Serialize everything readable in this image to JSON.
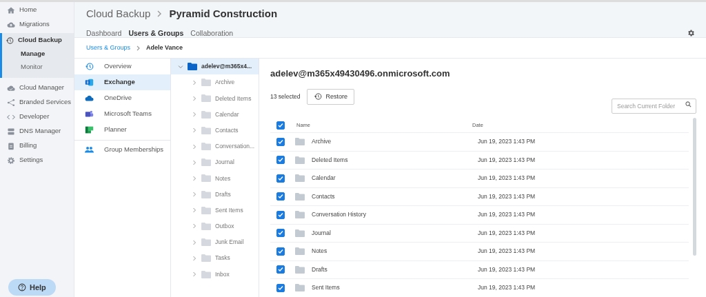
{
  "sidebar": {
    "items": [
      {
        "label": "Home",
        "selected": false
      },
      {
        "label": "Migrations",
        "selected": false
      },
      {
        "label": "Cloud Backup",
        "selected": true,
        "expanded": true,
        "children": [
          {
            "label": "Manage",
            "selected": true
          },
          {
            "label": "Monitor",
            "selected": false
          }
        ]
      },
      {
        "label": "Cloud Manager",
        "selected": false
      },
      {
        "label": "Branded Services",
        "selected": false
      },
      {
        "label": "Developer",
        "selected": false
      },
      {
        "label": "DNS Manager",
        "selected": false
      },
      {
        "label": "Billing",
        "selected": false
      },
      {
        "label": "Settings",
        "selected": false
      }
    ],
    "help": "Help"
  },
  "header": {
    "title": "Cloud Backup",
    "subtitle": "Pyramid Construction",
    "tabs": [
      {
        "label": "Dashboard",
        "selected": false
      },
      {
        "label": "Users & Groups",
        "selected": true
      },
      {
        "label": "Collaboration",
        "selected": false
      }
    ]
  },
  "breadcrumb": {
    "link": "Users & Groups",
    "current": "Adele Vance"
  },
  "services": [
    {
      "label": "Overview",
      "selected": false
    },
    {
      "label": "Exchange",
      "selected": true
    },
    {
      "label": "OneDrive",
      "selected": false
    },
    {
      "label": "Microsoft Teams",
      "selected": false
    },
    {
      "label": "Planner",
      "selected": false
    },
    {
      "label": "Group Memberships",
      "selected": false
    }
  ],
  "tree": [
    {
      "label": "adelev@m365x4...",
      "selected": true,
      "expanded": true,
      "children": [
        {
          "label": "Archive",
          "selected": false,
          "expanded": false
        },
        {
          "label": "Deleted Items",
          "selected": false,
          "expanded": false
        },
        {
          "label": "Calendar",
          "selected": false,
          "expanded": false
        },
        {
          "label": "Contacts",
          "selected": false,
          "expanded": false
        },
        {
          "label": "Conversation...",
          "selected": false,
          "expanded": false
        },
        {
          "label": "Journal",
          "selected": false,
          "expanded": false
        },
        {
          "label": "Notes",
          "selected": false,
          "expanded": false
        },
        {
          "label": "Drafts",
          "selected": false,
          "expanded": false
        },
        {
          "label": "Sent Items",
          "selected": false,
          "expanded": false
        },
        {
          "label": "Outbox",
          "selected": false,
          "expanded": false
        },
        {
          "label": "Junk Email",
          "selected": false,
          "expanded": false
        },
        {
          "label": "Tasks",
          "selected": false,
          "expanded": false
        },
        {
          "label": "Inbox",
          "selected": false,
          "expanded": false
        }
      ]
    }
  ],
  "content": {
    "title": "adelev@m365x49430496.onmicrosoft.com",
    "selected_count": "13 selected",
    "restore": "Restore",
    "search": {
      "placeholder": "Search Current Folder"
    },
    "table": {
      "all_checked": true,
      "columns": [
        "Name",
        "Date"
      ],
      "rows": [
        {
          "name": "Archive",
          "date": "Jun 19, 2023 1:43 PM",
          "checked": true
        },
        {
          "name": "Deleted Items",
          "date": "Jun 19, 2023 1:43 PM",
          "checked": true
        },
        {
          "name": "Calendar",
          "date": "Jun 19, 2023 1:43 PM",
          "checked": true
        },
        {
          "name": "Contacts",
          "date": "Jun 19, 2023 1:43 PM",
          "checked": true
        },
        {
          "name": "Conversation History",
          "date": "Jun 19, 2023 1:43 PM",
          "checked": true
        },
        {
          "name": "Journal",
          "date": "Jun 19, 2023 1:43 PM",
          "checked": true
        },
        {
          "name": "Notes",
          "date": "Jun 19, 2023 1:43 PM",
          "checked": true
        },
        {
          "name": "Drafts",
          "date": "Jun 19, 2023 1:43 PM",
          "checked": true
        },
        {
          "name": "Sent Items",
          "date": "Jun 19, 2023 1:43 PM",
          "checked": true
        }
      ]
    }
  }
}
